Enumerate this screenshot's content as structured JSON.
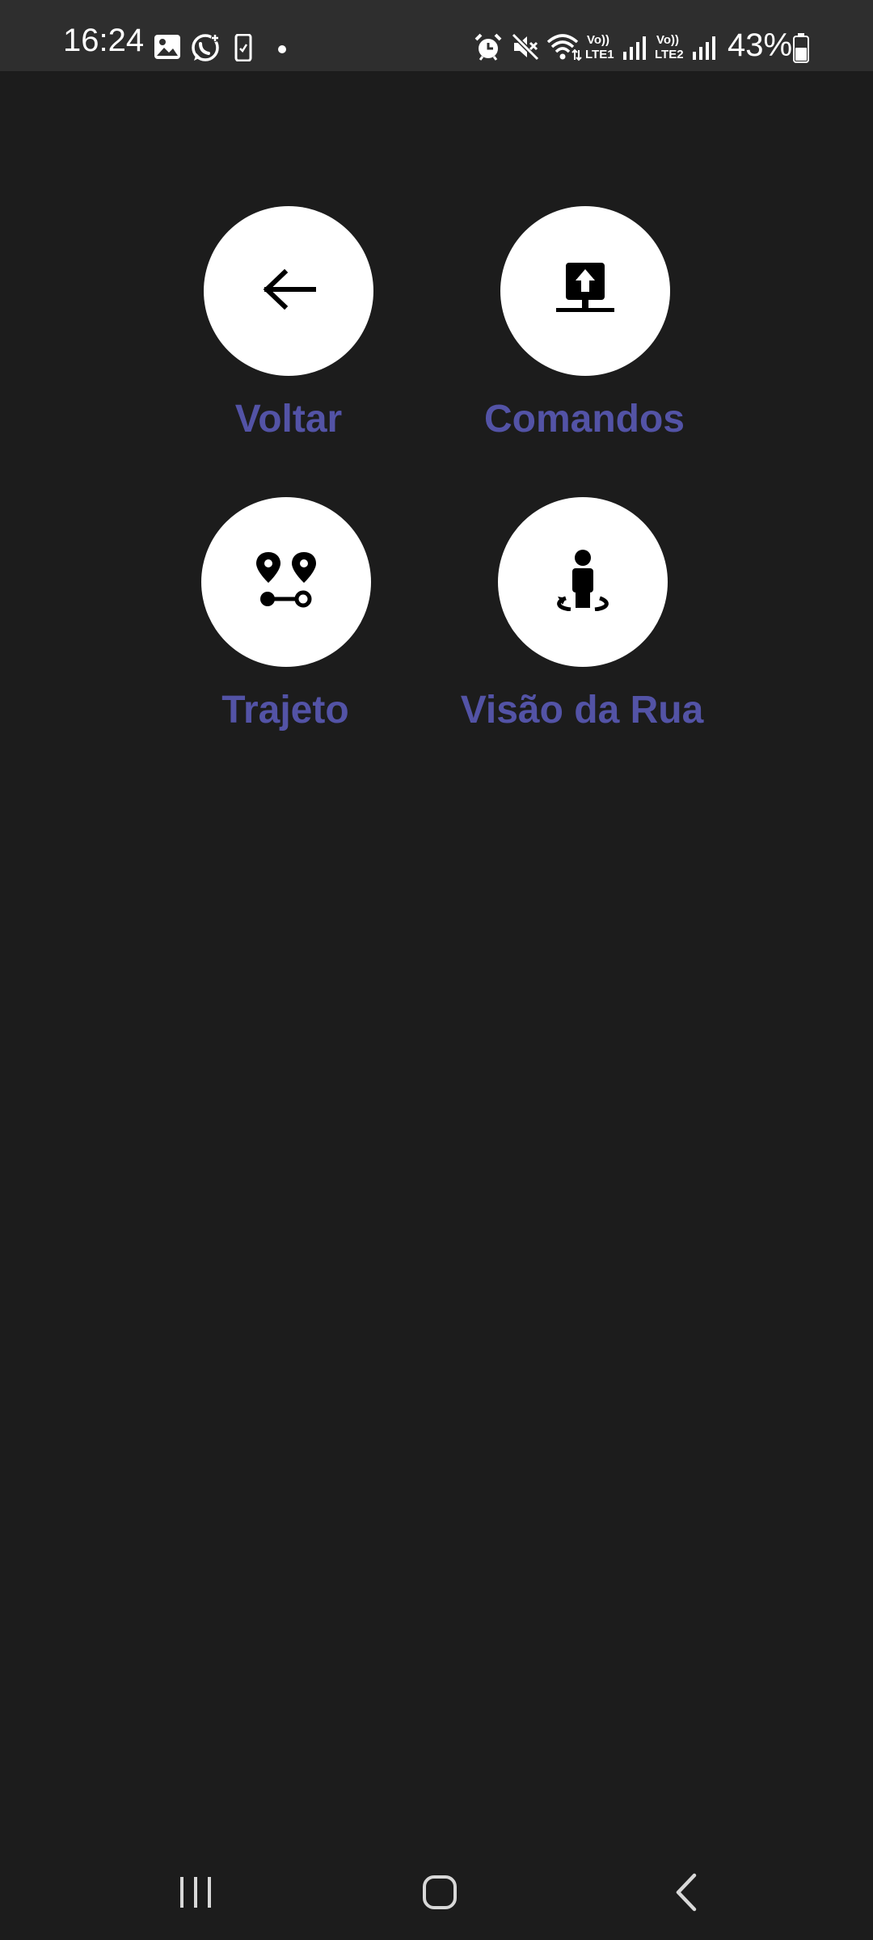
{
  "status_bar": {
    "time": "16:24",
    "battery_percent": "43%",
    "sim1_volte": "Vo))",
    "sim1_network": "LTE1",
    "sim2_volte": "Vo))",
    "sim2_network": "LTE2",
    "notification_icons": [
      "gallery-icon",
      "whatsapp-icon",
      "phone-device-icon",
      "dot-icon"
    ],
    "system_icons": [
      "alarm-icon",
      "mute-icon",
      "wifi-icon",
      "signal-icon",
      "signal-icon",
      "battery-icon"
    ]
  },
  "menu": {
    "items": [
      {
        "label": "Voltar",
        "icon": "arrow-left-icon"
      },
      {
        "label": "Comandos",
        "icon": "upload-command-icon"
      },
      {
        "label": "Trajeto",
        "icon": "route-icon"
      },
      {
        "label": "Visão da Rua",
        "icon": "street-view-icon"
      }
    ]
  },
  "colors": {
    "background": "#1c1c1c",
    "status_bar": "#2e2e2e",
    "label_accent": "#5353a6",
    "circle": "#ffffff"
  },
  "nav_bar": {
    "buttons": [
      "recent-apps-icon",
      "home-icon",
      "back-icon"
    ]
  }
}
